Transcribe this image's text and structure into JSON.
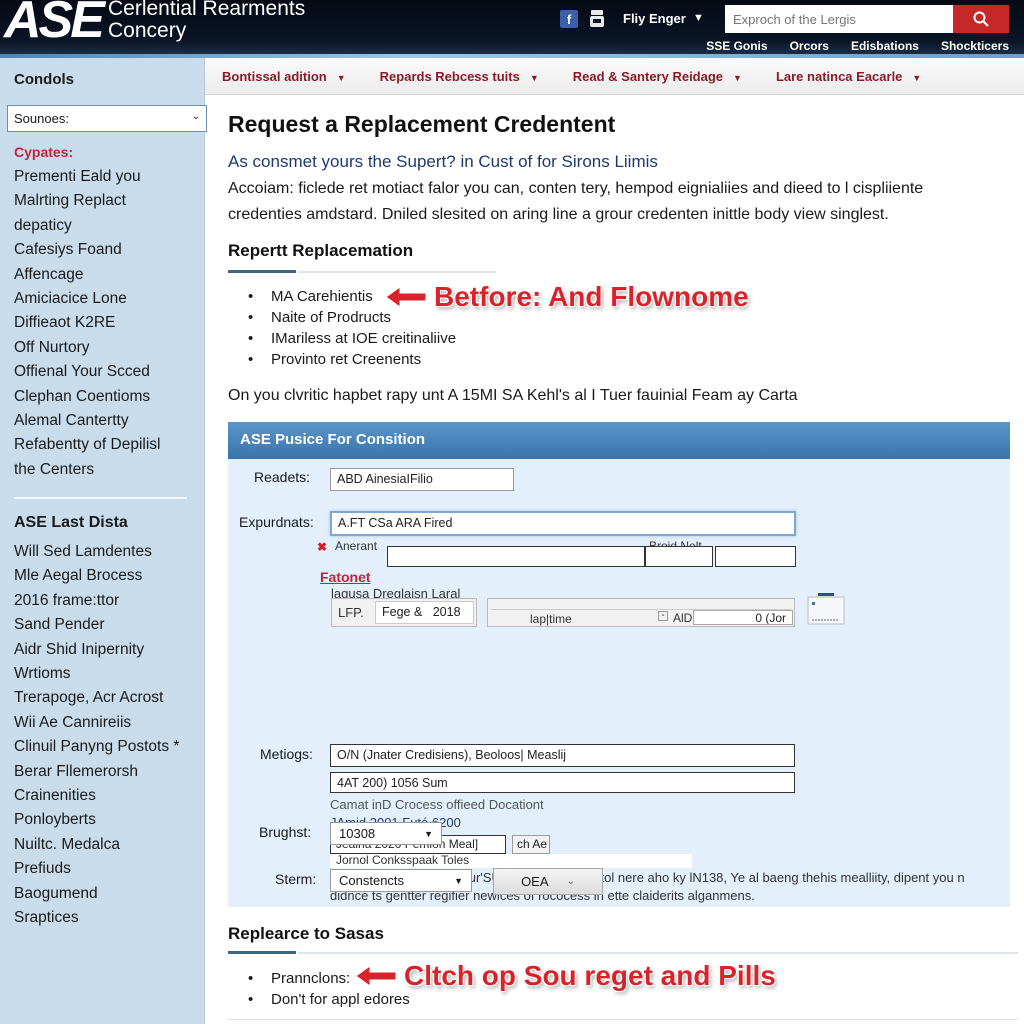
{
  "header": {
    "logo": "ASE",
    "logo_sub_line1": "Cerlential Rearments",
    "logo_sub_line2": "Concery",
    "social_icon": "facebook-icon",
    "user_icon": "user-badge-icon",
    "user_name": "Fliy Enger",
    "search_placeholder": "Exproch of the Lergis",
    "search_icon": "search-icon",
    "top_links": [
      "SSE Gonis",
      "Orcors",
      "Edisbations",
      "Shockticers"
    ]
  },
  "sidebar": {
    "title": "Condols",
    "select_value": "Sounoes:",
    "section_red": "Cypates:",
    "items": [
      "Prementi Eald you",
      "Malrting Replact",
      "depaticy",
      "Cafesiys Foand",
      "Affencage",
      "Amiciacice Lone",
      "Diffieaot K2RE",
      "Off Nurtory",
      "Offienal Your Scced",
      "Clephan Coentioms",
      "Alemal Cantertty",
      "Refabentty of Depilisl",
      "the Centers"
    ],
    "section2_title": "ASE Last Dista",
    "items2": [
      "Will Sed Lamdentes",
      "Mle Aegal Brocess",
      "2016 frame:ttor",
      "Sand Pender",
      "Aidr Shid Inipernity",
      "Wrtioms",
      "Trerapoge, Acr Acrost",
      "Wii Ae Cannireiis",
      "Clinuil Panyng Postots *",
      "Berar Fllemerorsh",
      "Crainenities",
      "Ponloyberts",
      "Nuiltc. Medalca",
      "Prefiuds",
      "Baogumend",
      "Sraptices"
    ]
  },
  "nav": {
    "items": [
      "Bontissal adition",
      "Repards Rebcess tuits",
      "Read & Santery Reidage",
      "Lare natinca Eacarle"
    ]
  },
  "main": {
    "title": "Request a Replacement Credentent",
    "subtitle": "As consmet yours the Supert? in Cust of for Sirons Liimis",
    "intro": "Accoiam: ficlede ret motiact falor you can, conten tery, hempod eignialiies and dieed to l cispliiente credenties amdstard. Dniled slesited on aring line a grour credenten inittle body view singlest.",
    "section1": {
      "title": "Repertt Replacemation",
      "bullets": [
        "MA Carehientis",
        "Naite of Prodructs",
        "IMariless at IOE creitinaliive",
        "Provinto ret Creenents"
      ],
      "annotation": "Betfore: And Flownome"
    },
    "note_line": "On you clvritic hapbet rapy unt A 15MI SA Kehl's al I Tuer fauinial Feam ay Carta",
    "form": {
      "header": "ASE Pusice For Consition",
      "readets_label": "Readets:",
      "readets_value": "ABD AinesiaIFilio",
      "expurdnats_label": "Expurdnats:",
      "expurdnats_value": "A.FT CSa ARA Fired",
      "anerant_label": "Anerant",
      "broid_label": "Broid Nelt",
      "red_link": "Fatonet",
      "sub_label": "lagusa Dreglaisn Laral",
      "table_cells": [
        "LFP.",
        "Fege &",
        "2018"
      ],
      "table2_cells": [
        "lap|time",
        "AlD",
        "0 (Jor"
      ],
      "metiogs_label": "Metiogs:",
      "metiogs_value1": "O/N (Jnater Credisiens), Beoloos| Measlij",
      "metiogs_value2": "4AT 200) 1056 Sum",
      "helper1": "Camat inD Crocess offieed Docationt",
      "helper2": "JAmid 2001 Futé 6200",
      "small_input": "Jeaina 2020 Pemion Meal]",
      "small_btn": "ch Ae",
      "popup_text": "Jornol Conksspaak Toles",
      "panel_note": "arlvorcuet resjriented your'SU EE and rejabled tol nere aho ky lN138, Ye al baeng thehis mealliity, dipent you n didnce ts gentter regifier newices of rococess in ette claiderits alganmens.",
      "brughst_label": "Brughst:",
      "brughst_value": "10308",
      "sterm_label": "Sterm:",
      "sterm_value": "Constencts",
      "oea_button": "OEA"
    },
    "section2": {
      "title": "Replearce to Sasas",
      "bullets": [
        "Prannclons:",
        "Don't for appl edores"
      ],
      "annotation": "Cltch op Sou reget and Pills"
    }
  },
  "colors": {
    "header_bg": "#050a14",
    "search_button": "#c62828",
    "nav_text": "#8b1a26",
    "sidebar_bg": "#c8dcec",
    "panel_bg": "#e3effb",
    "panel_header": "#3a74ac",
    "annotation_red": "#d8232a"
  }
}
